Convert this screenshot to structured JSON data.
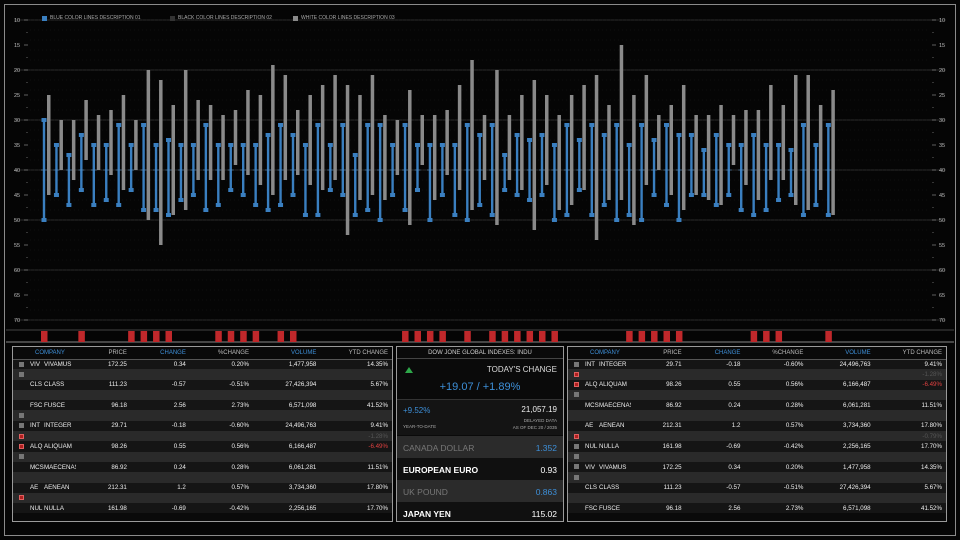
{
  "legend": [
    {
      "label": "BLUE COLOR LINES DESCRIPTION 01",
      "color": "#3a7fc0"
    },
    {
      "label": "BLACK COLOR LINES DESCRIPTION 02",
      "color": "#333333"
    },
    {
      "label": "WHITE COLOR LINES DESCRIPTION 03",
      "color": "#8a8a8a"
    }
  ],
  "chart_data": {
    "type": "bar",
    "y_ticks": [
      "10",
      "15",
      "20",
      "25",
      "30",
      "35",
      "40",
      "45",
      "50",
      "55",
      "60",
      "65",
      "70"
    ],
    "ylim": [
      10,
      70
    ],
    "series": [
      {
        "color": "#3a7fc0",
        "lows": [
          30,
          35,
          37,
          33,
          35,
          35,
          31,
          35,
          31,
          35,
          34,
          35,
          35,
          31,
          35,
          35,
          35,
          35,
          33,
          31,
          33,
          35,
          31,
          35,
          31,
          37,
          31,
          31,
          35,
          31,
          35,
          35,
          35,
          35,
          31,
          33,
          31,
          37,
          33,
          34,
          33,
          35,
          31,
          34,
          31,
          33,
          31,
          35,
          31,
          34,
          31,
          33,
          33,
          36,
          33,
          35,
          35,
          33,
          35,
          35,
          36,
          31,
          35,
          31
        ],
        "highs": [
          50,
          45,
          47,
          44,
          47,
          46,
          47,
          44,
          48,
          48,
          49,
          46,
          45,
          48,
          47,
          44,
          45,
          47,
          48,
          47,
          45,
          49,
          49,
          44,
          45,
          49,
          48,
          50,
          45,
          48,
          44,
          50,
          45,
          49,
          50,
          47,
          49,
          44,
          45,
          46,
          45,
          50,
          49,
          44,
          49,
          47,
          50,
          49,
          50,
          45,
          47,
          50,
          45,
          45,
          47,
          45,
          48,
          49,
          48,
          46,
          45,
          49,
          47,
          49
        ]
      },
      {
        "color": "#8a8a8a",
        "lows": [
          25,
          30,
          30,
          26,
          29,
          28,
          25,
          30,
          20,
          22,
          27,
          20,
          26,
          27,
          29,
          28,
          24,
          25,
          19,
          21,
          28,
          25,
          23,
          21,
          23,
          25,
          21,
          29,
          30,
          24,
          29,
          29,
          28,
          23,
          18,
          29,
          20,
          29,
          25,
          22,
          25,
          29,
          25,
          23,
          21,
          27,
          15,
          25,
          21,
          29,
          27,
          23,
          29,
          29,
          27,
          29,
          28,
          28,
          23,
          27,
          21,
          21,
          27,
          24
        ],
        "highs": [
          45,
          40,
          42,
          38,
          40,
          41,
          44,
          40,
          50,
          55,
          49,
          48,
          42,
          42,
          42,
          39,
          41,
          43,
          45,
          42,
          41,
          43,
          44,
          42,
          53,
          46,
          45,
          46,
          41,
          51,
          39,
          46,
          41,
          44,
          48,
          42,
          51,
          42,
          44,
          52,
          43,
          48,
          47,
          44,
          54,
          46,
          46,
          51,
          43,
          40,
          45,
          48,
          45,
          46,
          47,
          39,
          43,
          46,
          42,
          42,
          47,
          48,
          44,
          49
        ]
      }
    ],
    "volume_bars": [
      1,
      0,
      0,
      1,
      0,
      0,
      0,
      1,
      1,
      1,
      1,
      0,
      0,
      0,
      1,
      1,
      1,
      1,
      0,
      1,
      1,
      0,
      0,
      0,
      0,
      0,
      0,
      0,
      0,
      1,
      1,
      1,
      1,
      0,
      1,
      0,
      1,
      1,
      1,
      1,
      1,
      1,
      0,
      0,
      0,
      0,
      0,
      1,
      1,
      1,
      1,
      1,
      0,
      0,
      0,
      0,
      0,
      1,
      1,
      1,
      0,
      0,
      0,
      1
    ]
  },
  "left_table": {
    "headers": [
      "COMPANY",
      "PRICE",
      "CHANGE",
      "%CHANGE",
      "VOLUME",
      "YTD CHANGE"
    ],
    "rows": [
      {
        "kind": "main",
        "mark": "gray",
        "sym": "VIV",
        "name": "VIVAMUS",
        "price": "172.25",
        "change": "0.34",
        "pct": "0.20%",
        "vol": "1,477,958",
        "ytd": "14.35%"
      },
      {
        "kind": "sub",
        "mark": "gray"
      },
      {
        "kind": "main",
        "mark": "none",
        "sym": "CLS",
        "name": "CLASS",
        "price": "111.23",
        "change": "-0.57",
        "pct": "-0.51%",
        "vol": "27,426,394",
        "ytd": "5.67%"
      },
      {
        "kind": "sub",
        "mark": "none"
      },
      {
        "kind": "main",
        "mark": "none",
        "sym": "FSC",
        "name": "FUSCE",
        "price": "96.18",
        "change": "2.56",
        "pct": "2.73%",
        "vol": "6,571,098",
        "ytd": "41.52%"
      },
      {
        "kind": "sub",
        "mark": "gray"
      },
      {
        "kind": "main",
        "mark": "gray",
        "sym": "INT",
        "name": "INTEGER",
        "price": "29.71",
        "change": "-0.18",
        "pct": "-0.60%",
        "vol": "24,496,763",
        "ytd": "9.41%"
      },
      {
        "kind": "sub",
        "mark": "red",
        "ytd": "-1.28%",
        "ytdneg": true
      },
      {
        "kind": "main",
        "mark": "red",
        "sym": "ALQ",
        "name": "ALIQUAM",
        "price": "98.26",
        "change": "0.55",
        "pct": "0.56%",
        "vol": "6,166,487",
        "ytd": "-6.49%",
        "ytdneg": true
      },
      {
        "kind": "sub",
        "mark": "gray"
      },
      {
        "kind": "main",
        "mark": "none",
        "sym": "MCS",
        "name": "MAECENAS",
        "price": "86.92",
        "change": "0.24",
        "pct": "0.28%",
        "vol": "6,061,281",
        "ytd": "11.51%"
      },
      {
        "kind": "sub",
        "mark": "none"
      },
      {
        "kind": "main",
        "mark": "none",
        "sym": "AE",
        "name": "AENEAN",
        "price": "212.31",
        "change": "1.2",
        "pct": "0.57%",
        "vol": "3,734,360",
        "ytd": "17.80%"
      },
      {
        "kind": "sub",
        "mark": "red"
      },
      {
        "kind": "main",
        "mark": "none",
        "sym": "NUL",
        "name": "NULLA",
        "price": "161.98",
        "change": "-0.69",
        "pct": "-0.42%",
        "vol": "2,256,165",
        "ytd": "17.70%"
      }
    ]
  },
  "right_table": {
    "headers": [
      "COMPANY",
      "PRICE",
      "CHANGE",
      "%CHANGE",
      "VOLUME",
      "YTD CHANGE"
    ],
    "rows": [
      {
        "kind": "main",
        "mark": "gray",
        "sym": "INT",
        "name": "INTEGER",
        "price": "29.71",
        "change": "-0.18",
        "pct": "-0.60%",
        "vol": "24,496,763",
        "ytd": "9.41%"
      },
      {
        "kind": "sub",
        "mark": "red",
        "ytd": "-1.28%",
        "ytdneg": true
      },
      {
        "kind": "main",
        "mark": "red",
        "sym": "ALQ",
        "name": "ALIQUAM",
        "price": "98.26",
        "change": "0.55",
        "pct": "0.56%",
        "vol": "6,166,487",
        "ytd": "-6.49%",
        "ytdneg": true
      },
      {
        "kind": "sub",
        "mark": "gray"
      },
      {
        "kind": "main",
        "mark": "none",
        "sym": "MCS",
        "name": "MAECENAS",
        "price": "86.92",
        "change": "0.24",
        "pct": "0.28%",
        "vol": "6,061,281",
        "ytd": "11.51%"
      },
      {
        "kind": "sub",
        "mark": "none"
      },
      {
        "kind": "main",
        "mark": "none",
        "sym": "AE",
        "name": "AENEAN",
        "price": "212.31",
        "change": "1.2",
        "pct": "0.57%",
        "vol": "3,734,360",
        "ytd": "17.80%"
      },
      {
        "kind": "sub",
        "mark": "red",
        "ytd": "-0.79%",
        "ytdneg": true
      },
      {
        "kind": "main",
        "mark": "gray",
        "sym": "NUL",
        "name": "NULLA",
        "price": "161.98",
        "change": "-0.69",
        "pct": "-0.42%",
        "vol": "2,256,165",
        "ytd": "17.70%"
      },
      {
        "kind": "sub",
        "mark": "gray"
      },
      {
        "kind": "main",
        "mark": "gray",
        "sym": "VIV",
        "name": "VIVAMUS",
        "price": "172.25",
        "change": "0.34",
        "pct": "0.20%",
        "vol": "1,477,958",
        "ytd": "14.35%"
      },
      {
        "kind": "sub",
        "mark": "gray"
      },
      {
        "kind": "main",
        "mark": "none",
        "sym": "CLS",
        "name": "CLASS",
        "price": "111.23",
        "change": "-0.57",
        "pct": "-0.51%",
        "vol": "27,426,394",
        "ytd": "5.67%"
      },
      {
        "kind": "sub",
        "mark": "none"
      },
      {
        "kind": "main",
        "mark": "none",
        "sym": "FSC",
        "name": "FUSCE",
        "price": "96.18",
        "change": "2.56",
        "pct": "2.73%",
        "vol": "6,571,098",
        "ytd": "41.52%"
      }
    ]
  },
  "center": {
    "title": "DOW JONE GLOBAL INDEXES: INDU",
    "today_label": "TODAY'S CHANGE",
    "today_change": "+19.07 / +1.89%",
    "ytd_pct": "+9.52%",
    "ytd_value": "21,057.19",
    "ytd_label": "YEAR-TO-DATE",
    "delayed": "DELAYED DATA",
    "asof": "AS OF DEC 20 / 2035",
    "fx": [
      {
        "name": "CANADA DOLLAR",
        "value": "1.352",
        "style": "dim"
      },
      {
        "name": "EUROPEAN EURO",
        "value": "0.93",
        "style": "bright"
      },
      {
        "name": "UK POUND",
        "value": "0.863",
        "style": "dim"
      },
      {
        "name": "JAPAN YEN",
        "value": "115.02",
        "style": "bright"
      }
    ]
  },
  "colors": {
    "accent_blue": "#3a7fc0",
    "bar_gray": "#8a8a8a",
    "volume_red": "#c0282b",
    "positive_green": "#2ea84a",
    "negative_red": "#e04040"
  }
}
